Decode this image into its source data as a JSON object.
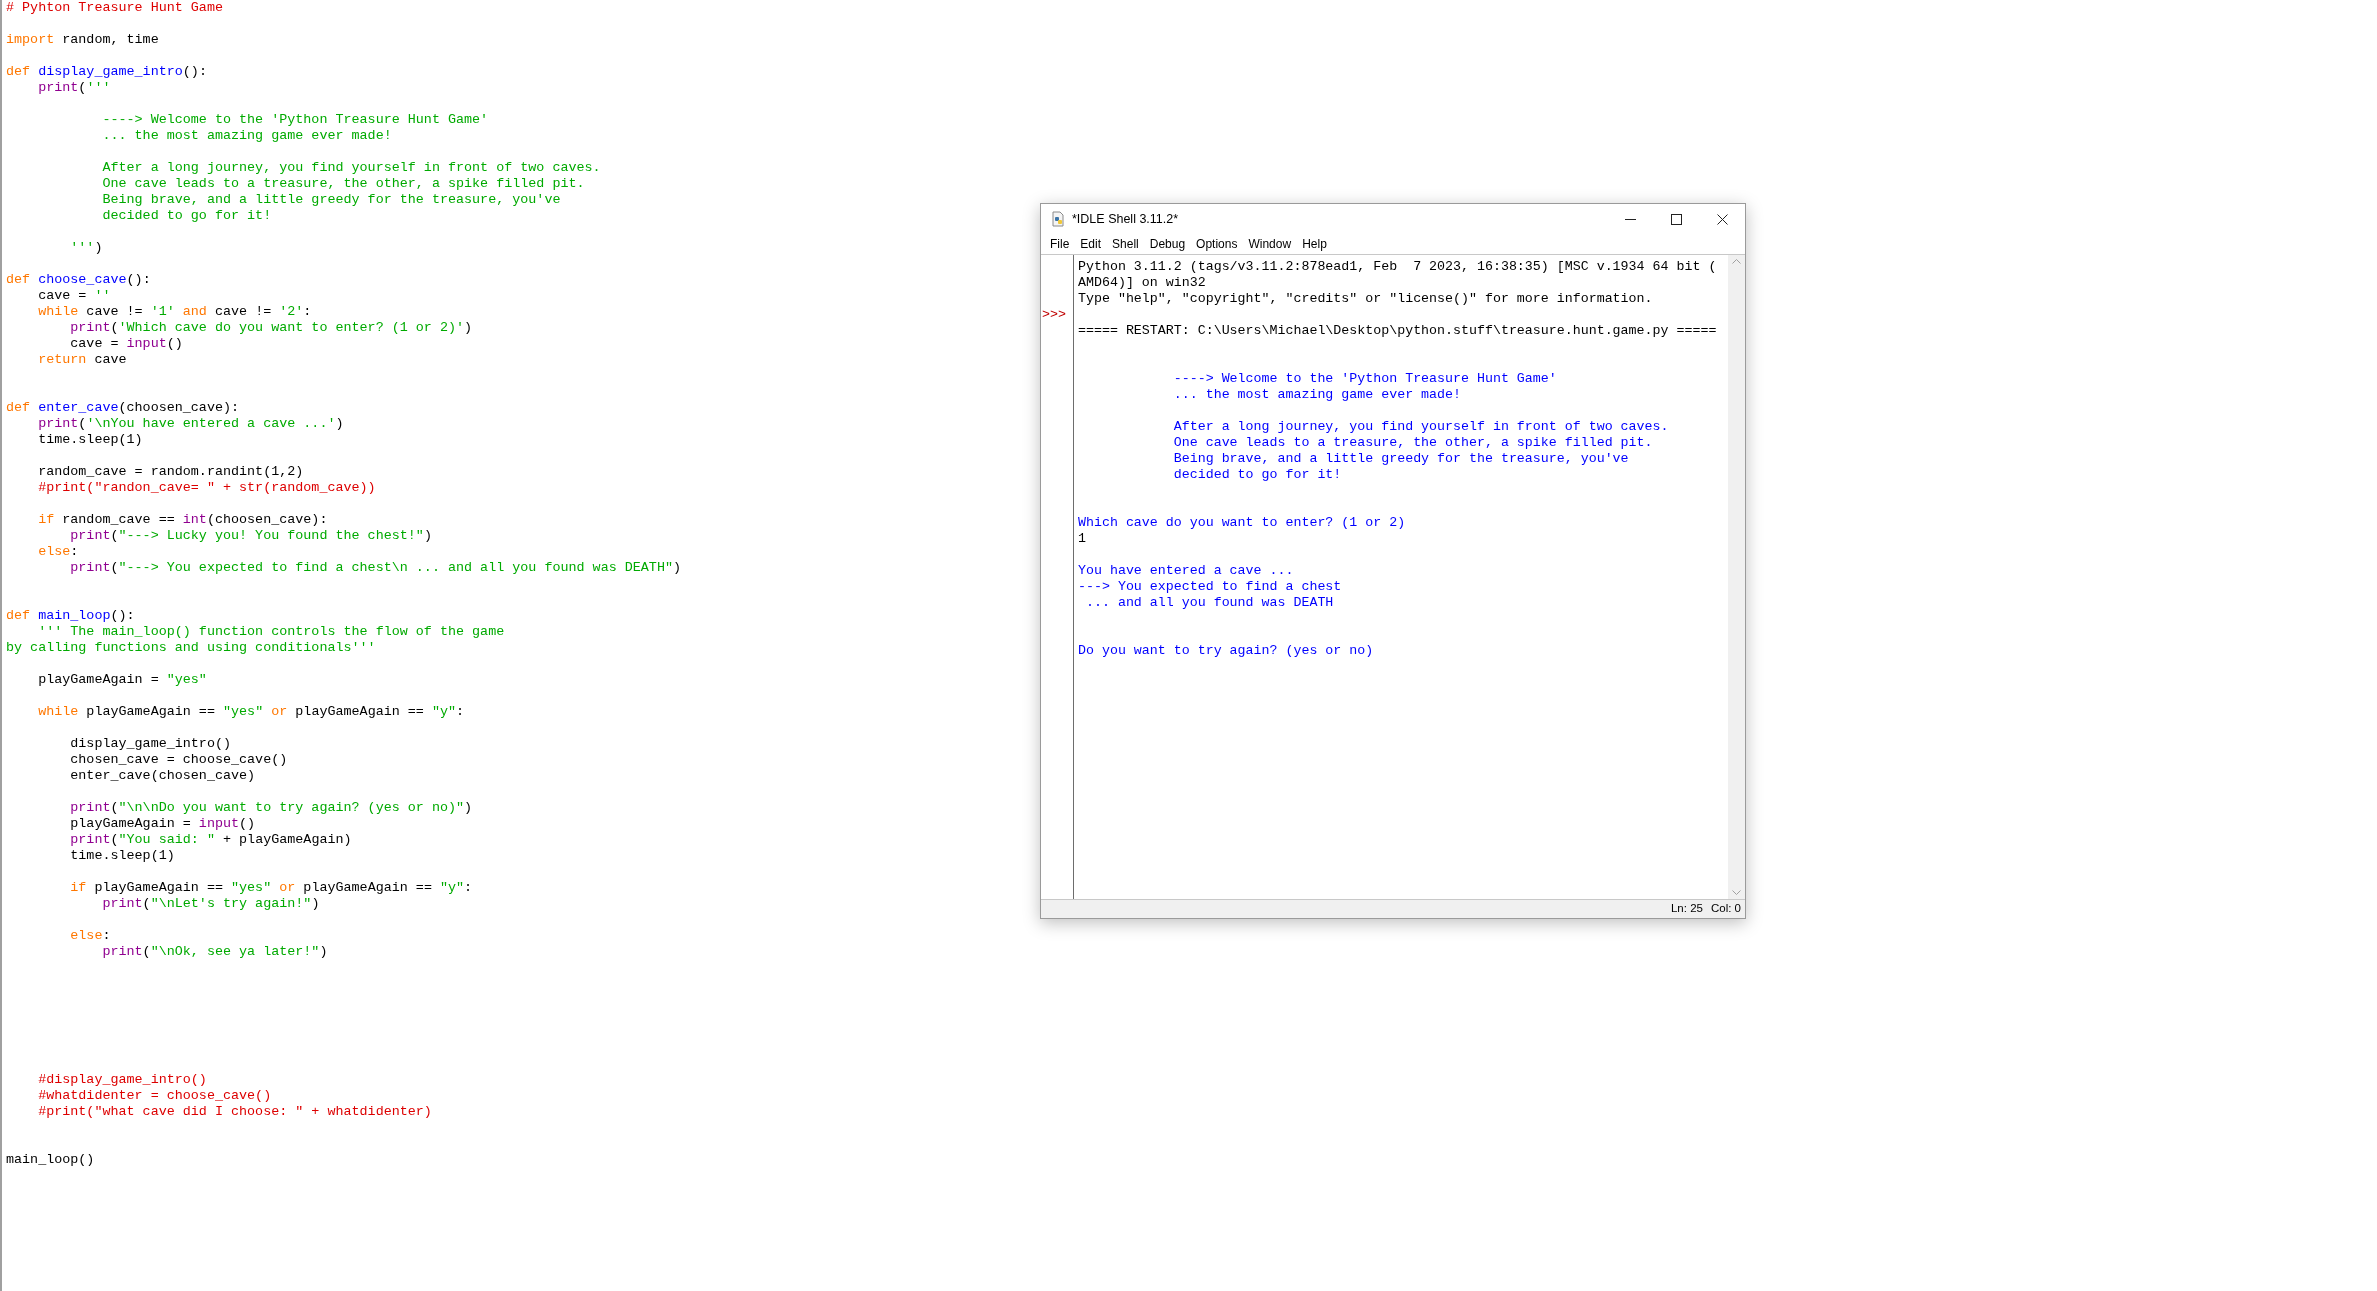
{
  "editor": {
    "lines": [
      {
        "tokens": [
          {
            "kind": "comment",
            "text": "# Pyhton Treasure Hunt Game"
          }
        ]
      },
      {
        "tokens": [
          {
            "kind": "keyword",
            "text": "import"
          },
          {
            "kind": "plain",
            "text": " random, time"
          }
        ]
      },
      {
        "tokens": [
          {
            "kind": "keyword",
            "text": "def "
          },
          {
            "kind": "definition",
            "text": "display_game_intro"
          },
          {
            "kind": "plain",
            "text": "():"
          }
        ]
      },
      {
        "tokens": [
          {
            "kind": "builtin",
            "text": "    print"
          },
          {
            "kind": "plain",
            "text": "("
          },
          {
            "kind": "string",
            "text": "'''"
          }
        ]
      },
      {
        "tokens": [
          {
            "kind": "string",
            "text": "            ----> Welcome to the 'Python Treasure Hunt Game'"
          }
        ]
      },
      {
        "tokens": [
          {
            "kind": "string",
            "text": "            ... the most amazing game ever made!"
          }
        ]
      },
      {
        "tokens": [
          {
            "kind": "string",
            "text": "            After a long journey, you find yourself in front of two caves."
          }
        ]
      },
      {
        "tokens": [
          {
            "kind": "string",
            "text": "            One cave leads to a treasure, the other, a spike filled pit."
          }
        ]
      },
      {
        "tokens": [
          {
            "kind": "string",
            "text": "            Being brave, and a little greedy for the treasure, you've"
          }
        ]
      },
      {
        "tokens": [
          {
            "kind": "string",
            "text": "            decided to go for it!"
          }
        ]
      },
      {
        "tokens": [
          {
            "kind": "string",
            "text": "        '''"
          },
          {
            "kind": "plain",
            "text": ")"
          }
        ]
      },
      {
        "tokens": [
          {
            "kind": "keyword",
            "text": "def "
          },
          {
            "kind": "definition",
            "text": "choose_cave"
          },
          {
            "kind": "plain",
            "text": "():"
          }
        ]
      },
      {
        "tokens": [
          {
            "kind": "plain",
            "text": "    cave = "
          },
          {
            "kind": "string",
            "text": "''"
          }
        ]
      },
      {
        "tokens": [
          {
            "kind": "keyword",
            "text": "    while"
          },
          {
            "kind": "plain",
            "text": " cave != "
          },
          {
            "kind": "string",
            "text": "'1'"
          },
          {
            "kind": "keyword",
            "text": " and"
          },
          {
            "kind": "plain",
            "text": " cave != "
          },
          {
            "kind": "string",
            "text": "'2'"
          },
          {
            "kind": "plain",
            "text": ":"
          }
        ]
      },
      {
        "tokens": [
          {
            "kind": "builtin",
            "text": "        print"
          },
          {
            "kind": "plain",
            "text": "("
          },
          {
            "kind": "string",
            "text": "'Which cave do you want to enter? (1 or 2)'"
          },
          {
            "kind": "plain",
            "text": ")"
          }
        ]
      },
      {
        "tokens": [
          {
            "kind": "plain",
            "text": "        cave = "
          },
          {
            "kind": "builtin",
            "text": "input"
          },
          {
            "kind": "plain",
            "text": "()"
          }
        ]
      },
      {
        "tokens": [
          {
            "kind": "keyword",
            "text": "    return"
          },
          {
            "kind": "plain",
            "text": " cave"
          }
        ]
      },
      {
        "tokens": [
          {
            "kind": "keyword",
            "text": "def "
          },
          {
            "kind": "definition",
            "text": "enter_cave"
          },
          {
            "kind": "plain",
            "text": "(choosen_cave):"
          }
        ]
      },
      {
        "tokens": [
          {
            "kind": "builtin",
            "text": "    print"
          },
          {
            "kind": "plain",
            "text": "("
          },
          {
            "kind": "string",
            "text": "'\\nYou have entered a cave ...'"
          },
          {
            "kind": "plain",
            "text": ")"
          }
        ]
      },
      {
        "tokens": [
          {
            "kind": "plain",
            "text": "    time.sleep(1)"
          }
        ]
      },
      {
        "tokens": [
          {
            "kind": "plain",
            "text": "    random_cave = random.randint(1,2)"
          }
        ]
      },
      {
        "tokens": [
          {
            "kind": "comment",
            "text": "    #print(\"randon_cave= \" + str(random_cave))"
          }
        ]
      },
      {
        "tokens": [
          {
            "kind": "keyword",
            "text": "    if"
          },
          {
            "kind": "plain",
            "text": " random_cave == "
          },
          {
            "kind": "builtin",
            "text": "int"
          },
          {
            "kind": "plain",
            "text": "(choosen_cave):"
          }
        ]
      },
      {
        "tokens": [
          {
            "kind": "builtin",
            "text": "        print"
          },
          {
            "kind": "plain",
            "text": "("
          },
          {
            "kind": "string",
            "text": "\"---> Lucky you! You found the chest!\""
          },
          {
            "kind": "plain",
            "text": ")"
          }
        ]
      },
      {
        "tokens": [
          {
            "kind": "keyword",
            "text": "    else"
          },
          {
            "kind": "plain",
            "text": ":"
          }
        ]
      },
      {
        "tokens": [
          {
            "kind": "builtin",
            "text": "        print"
          },
          {
            "kind": "plain",
            "text": "("
          },
          {
            "kind": "string",
            "text": "\"---> You expected to find a chest\\n ... and all you found was DEATH\""
          },
          {
            "kind": "plain",
            "text": ")"
          }
        ]
      },
      {
        "tokens": [
          {
            "kind": "keyword",
            "text": "def "
          },
          {
            "kind": "definition",
            "text": "main_loop"
          },
          {
            "kind": "plain",
            "text": "():"
          }
        ]
      },
      {
        "tokens": [
          {
            "kind": "string",
            "text": "    ''' The main_loop() function controls the flow of the game"
          }
        ]
      },
      {
        "tokens": [
          {
            "kind": "string",
            "text": "by calling functions and using conditionals'''"
          }
        ]
      },
      {
        "tokens": [
          {
            "kind": "plain",
            "text": "    playGameAgain = "
          },
          {
            "kind": "string",
            "text": "\"yes\""
          }
        ]
      },
      {
        "tokens": [
          {
            "kind": "keyword",
            "text": "    while"
          },
          {
            "kind": "plain",
            "text": " playGameAgain == "
          },
          {
            "kind": "string",
            "text": "\"yes\""
          },
          {
            "kind": "keyword",
            "text": " or"
          },
          {
            "kind": "plain",
            "text": " playGameAgain == "
          },
          {
            "kind": "string",
            "text": "\"y\""
          },
          {
            "kind": "plain",
            "text": ":"
          }
        ]
      },
      {
        "tokens": [
          {
            "kind": "plain",
            "text": "        display_game_intro()"
          }
        ]
      },
      {
        "tokens": [
          {
            "kind": "plain",
            "text": "        chosen_cave = choose_cave()"
          }
        ]
      },
      {
        "tokens": [
          {
            "kind": "plain",
            "text": "        enter_cave(chosen_cave)"
          }
        ]
      },
      {
        "tokens": [
          {
            "kind": "builtin",
            "text": "        print"
          },
          {
            "kind": "plain",
            "text": "("
          },
          {
            "kind": "string",
            "text": "\"\\n\\nDo you want to try again? (yes or no)\""
          },
          {
            "kind": "plain",
            "text": ")"
          }
        ]
      },
      {
        "tokens": [
          {
            "kind": "plain",
            "text": "        playGameAgain = "
          },
          {
            "kind": "builtin",
            "text": "input"
          },
          {
            "kind": "plain",
            "text": "()"
          }
        ]
      },
      {
        "tokens": [
          {
            "kind": "builtin",
            "text": "        print"
          },
          {
            "kind": "plain",
            "text": "("
          },
          {
            "kind": "string",
            "text": "\"You said: \""
          },
          {
            "kind": "plain",
            "text": " + playGameAgain)"
          }
        ]
      },
      {
        "tokens": [
          {
            "kind": "plain",
            "text": "        time.sleep(1)"
          }
        ]
      },
      {
        "tokens": [
          {
            "kind": "keyword",
            "text": "        if"
          },
          {
            "kind": "plain",
            "text": " playGameAgain == "
          },
          {
            "kind": "string",
            "text": "\"yes\""
          },
          {
            "kind": "keyword",
            "text": " or"
          },
          {
            "kind": "plain",
            "text": " playGameAgain == "
          },
          {
            "kind": "string",
            "text": "\"y\""
          },
          {
            "kind": "plain",
            "text": ":"
          }
        ]
      },
      {
        "tokens": [
          {
            "kind": "builtin",
            "text": "            print"
          },
          {
            "kind": "plain",
            "text": "("
          },
          {
            "kind": "string",
            "text": "\"\\nLet's try again!\""
          },
          {
            "kind": "plain",
            "text": ")"
          }
        ]
      },
      {
        "tokens": [
          {
            "kind": "keyword",
            "text": "        else"
          },
          {
            "kind": "plain",
            "text": ":"
          }
        ]
      },
      {
        "tokens": [
          {
            "kind": "builtin",
            "text": "            print"
          },
          {
            "kind": "plain",
            "text": "("
          },
          {
            "kind": "string",
            "text": "\"\\nOk, see ya later!\""
          },
          {
            "kind": "plain",
            "text": ")"
          }
        ]
      },
      {
        "tokens": [
          {
            "kind": "comment",
            "text": "    #display_game_intro()"
          }
        ]
      },
      {
        "tokens": [
          {
            "kind": "comment",
            "text": "    #whatdidenter = choose_cave()"
          }
        ]
      },
      {
        "tokens": [
          {
            "kind": "comment",
            "text": "    #print(\"what cave did I choose: \" + whatdidenter)"
          }
        ]
      },
      {
        "tokens": [
          {
            "kind": "plain",
            "text": "main_loop()"
          }
        ]
      }
    ]
  },
  "shell": {
    "title": "*IDLE Shell 3.11.2*",
    "menu": [
      "File",
      "Edit",
      "Shell",
      "Debug",
      "Options",
      "Window",
      "Help"
    ],
    "prompt": ">>>",
    "lines": [
      {
        "kind": "plain",
        "text": "Python 3.11.2 (tags/v3.11.2:878ead1, Feb  7 2023, 16:38:35) [MSC v.1934 64 bit ("
      },
      {
        "kind": "plain",
        "text": "AMD64)] on win32"
      },
      {
        "kind": "plain",
        "text": "Type \"help\", \"copyright\", \"credits\" or \"license()\" for more information."
      },
      {
        "kind": "plain",
        "text": "===== RESTART: C:\\Users\\Michael\\Desktop\\python.stuff\\treasure.hunt.game.py ====="
      },
      {
        "kind": "output",
        "text": "            ----> Welcome to the 'Python Treasure Hunt Game'"
      },
      {
        "kind": "output",
        "text": "            ... the most amazing game ever made!"
      },
      {
        "kind": "output",
        "text": "            After a long journey, you find yourself in front of two caves."
      },
      {
        "kind": "output",
        "text": "            One cave leads to a treasure, the other, a spike filled pit."
      },
      {
        "kind": "output",
        "text": "            Being brave, and a little greedy for the treasure, you've"
      },
      {
        "kind": "output",
        "text": "            decided to go for it!"
      },
      {
        "kind": "output",
        "text": "Which cave do you want to enter? (1 or 2)"
      },
      {
        "kind": "input",
        "text": "1"
      },
      {
        "kind": "output",
        "text": "You have entered a cave ..."
      },
      {
        "kind": "output",
        "text": "---> You expected to find a chest"
      },
      {
        "kind": "output",
        "text": " ... and all you found was DEATH"
      },
      {
        "kind": "output",
        "text": "Do you want to try again? (yes or no)"
      }
    ],
    "status": [
      "Ln: 25",
      "Col: 0"
    ]
  }
}
